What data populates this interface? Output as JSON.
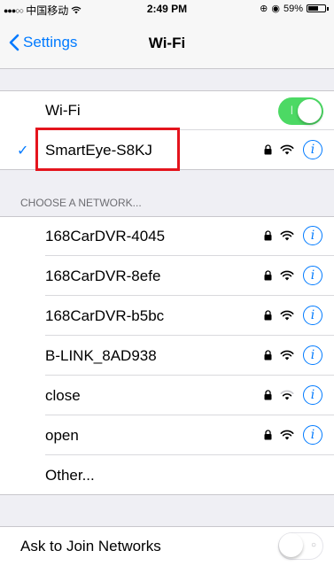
{
  "status_bar": {
    "carrier": "中国移动",
    "time": "2:49 PM",
    "battery_percent": "59%",
    "battery_level": 0.59
  },
  "nav": {
    "back_label": "Settings",
    "title": "Wi-Fi"
  },
  "wifi_toggle": {
    "label": "Wi-Fi",
    "on": true
  },
  "connected_network": {
    "name": "SmartEye-S8KJ",
    "secured": true
  },
  "choose_header": "CHOOSE A NETWORK...",
  "networks": [
    {
      "name": "168CarDVR-4045",
      "secured": true,
      "signal": "full"
    },
    {
      "name": "168CarDVR-8efe",
      "secured": true,
      "signal": "full"
    },
    {
      "name": "168CarDVR-b5bc",
      "secured": true,
      "signal": "full"
    },
    {
      "name": "B-LINK_8AD938",
      "secured": true,
      "signal": "full"
    },
    {
      "name": "close",
      "secured": true,
      "signal": "weak"
    },
    {
      "name": "open",
      "secured": true,
      "signal": "full"
    }
  ],
  "other_label": "Other...",
  "ask_to_join": {
    "label": "Ask to Join Networks",
    "on": false
  },
  "colors": {
    "accent": "#007aff",
    "toggle_on": "#4cd964",
    "highlight": "#e4141d"
  },
  "icons": {
    "lock": "lock-icon",
    "wifi": "wifi-icon",
    "info": "info-icon",
    "check": "checkmark-icon",
    "back": "chevron-left-icon"
  }
}
